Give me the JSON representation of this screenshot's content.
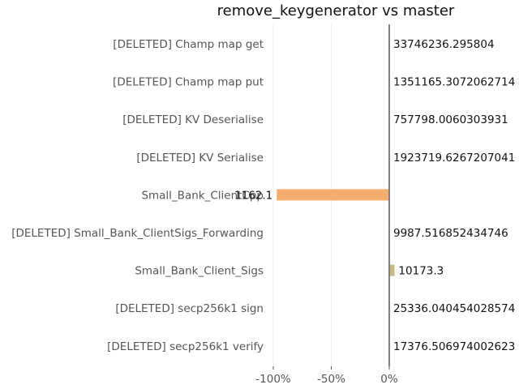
{
  "chart_data": {
    "type": "bar",
    "orientation": "horizontal",
    "title": "remove_keygenerator vs master",
    "xlabel": "",
    "ylabel": "",
    "xlim": [
      -100,
      0
    ],
    "xticks": [
      "-100%",
      "-50%",
      "0%"
    ],
    "xtick_values": [
      -100,
      -50,
      0
    ],
    "grid": "vertical",
    "categories": [
      "[DELETED] Champ map get",
      "[DELETED] Champ map put",
      "[DELETED] KV Deserialise",
      "[DELETED] KV Serialise",
      "Small_Bank_ClientCpp",
      "[DELETED] Small_Bank_ClientSigs_Forwarding",
      "Small_Bank_Client_Sigs",
      "[DELETED] secp256k1 sign",
      "[DELETED] secp256k1 verify"
    ],
    "values": [
      0,
      0,
      0,
      0,
      -97,
      0,
      4.5,
      0,
      0
    ],
    "labels": [
      "33746236.295804",
      "1351165.3072062714",
      "757798.0060303931",
      "1923719.6267207041",
      "1162.1",
      "9987.516852434746",
      "10173.3",
      "25336.040454028574",
      "17376.506974002623"
    ],
    "bar_colors": [
      "#f4ad6e",
      "#f4ad6e",
      "#f4ad6e",
      "#f4ad6e",
      "#f4ad6e",
      "#f4ad6e",
      "#c8ba7e",
      "#f4ad6e",
      "#f4ad6e"
    ],
    "colors": {
      "text": "#555555",
      "title": "#111111",
      "value_label": "#111111",
      "zero_line": "#808080",
      "grid": "#eeeeee"
    }
  }
}
